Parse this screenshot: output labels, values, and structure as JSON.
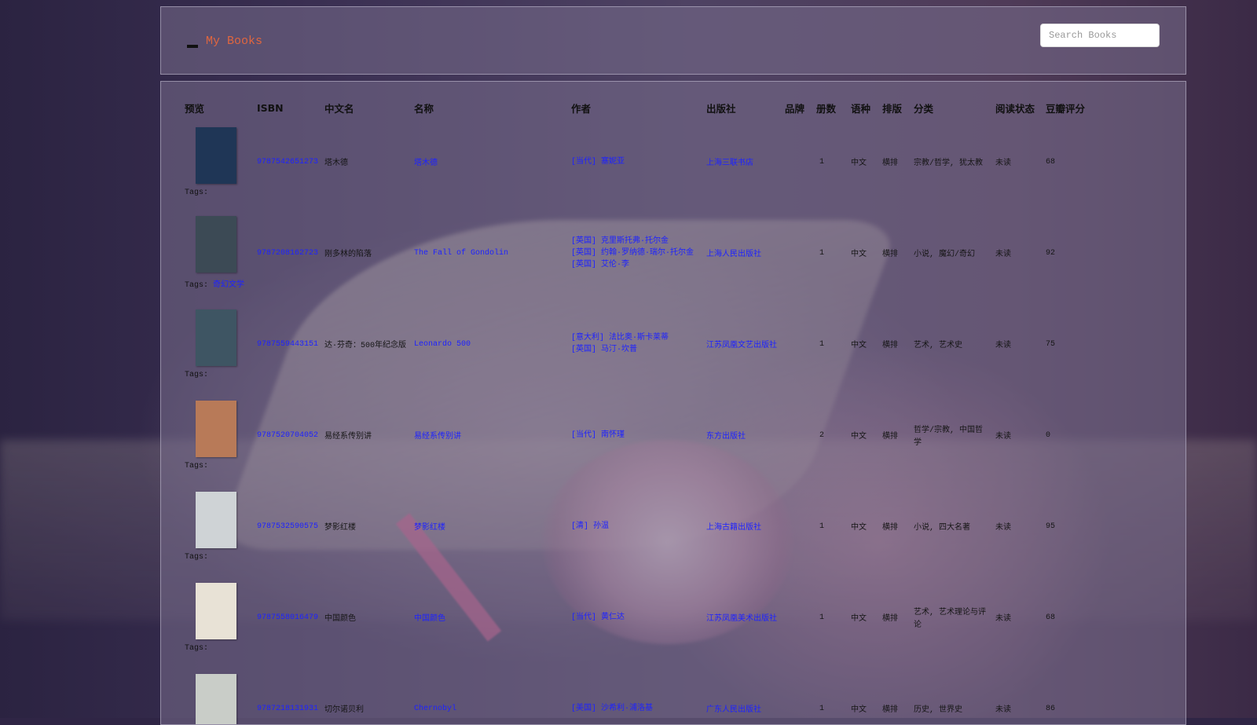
{
  "header": {
    "brand": "My Books",
    "search_placeholder": "Search Books"
  },
  "table": {
    "columns": [
      "预览",
      "ISBN",
      "中文名",
      "名称",
      "作者",
      "出版社",
      "品牌",
      "册数",
      "语种",
      "排版",
      "分类",
      "阅读状态",
      "豆瓣评分"
    ],
    "tags_label": "Tags:",
    "rows": [
      {
        "cover_color": "#1f3656",
        "isbn": "9787542651273",
        "cn_name": "塔木德",
        "name": "塔木德",
        "authors": [
          "[当代] 塞妮亚"
        ],
        "publisher": "上海三联书店",
        "count": "1",
        "lang": "中文",
        "layout": "横排",
        "category": "宗教/哲学, 犹太教",
        "status": "未读",
        "score": "68",
        "tags": ""
      },
      {
        "cover_color": "#3c4a55",
        "isbn": "9787208162723",
        "cn_name": "刚多林的陷落",
        "name": "The Fall of Gondolin",
        "authors": [
          "[英国] 克里斯托弗·托尔金",
          "[英国] 约翰·罗纳德·瑞尔·托尔金",
          "[英国] 艾伦·李"
        ],
        "publisher": "上海人民出版社",
        "count": "1",
        "lang": "中文",
        "layout": "横排",
        "category": "小说, 魔幻/奇幻",
        "status": "未读",
        "score": "92",
        "tags": "奇幻文学"
      },
      {
        "cover_color": "#3e5563",
        "isbn": "9787559443151",
        "cn_name": "达·芬奇：500年纪念版",
        "name": "Leonardo 500",
        "authors": [
          "[意大利] 法比奥·斯卡莱蒂",
          "[英国] 马汀·坎普"
        ],
        "publisher": "江苏凤凰文艺出版社",
        "count": "1",
        "lang": "中文",
        "layout": "横排",
        "category": "艺术, 艺术史",
        "status": "未读",
        "score": "75",
        "tags": ""
      },
      {
        "cover_color": "#b87a58",
        "isbn": "9787520704052",
        "cn_name": "易经系传别讲",
        "name": "易经系传别讲",
        "authors": [
          "[当代] 南怀瑾"
        ],
        "publisher": "东方出版社",
        "count": "2",
        "lang": "中文",
        "layout": "横排",
        "category": "哲学/宗教, 中国哲学",
        "status": "未读",
        "score": "0",
        "tags": ""
      },
      {
        "cover_color": "#cfd3d6",
        "isbn": "9787532590575",
        "cn_name": "梦影红楼",
        "name": "梦影红楼",
        "authors": [
          "[清] 孙温"
        ],
        "publisher": "上海古籍出版社",
        "count": "1",
        "lang": "中文",
        "layout": "横排",
        "category": "小说, 四大名著",
        "status": "未读",
        "score": "95",
        "tags": ""
      },
      {
        "cover_color": "#e8e2d6",
        "isbn": "9787558016479",
        "cn_name": "中国颜色",
        "name": "中国颜色",
        "authors": [
          "[当代] 黄仁达"
        ],
        "publisher": "江苏凤凰美术出版社",
        "count": "1",
        "lang": "中文",
        "layout": "横排",
        "category": "艺术, 艺术理论与评论",
        "status": "未读",
        "score": "68",
        "tags": ""
      },
      {
        "cover_color": "#c9cdc8",
        "isbn": "9787218131931",
        "cn_name": "切尔诺贝利",
        "name": "Chernobyl",
        "authors": [
          "[美国] 沙希利·浦洛基"
        ],
        "publisher": "广东人民出版社",
        "count": "1",
        "lang": "中文",
        "layout": "横排",
        "category": "历史, 世界史",
        "status": "未读",
        "score": "86",
        "tags": ""
      }
    ]
  }
}
